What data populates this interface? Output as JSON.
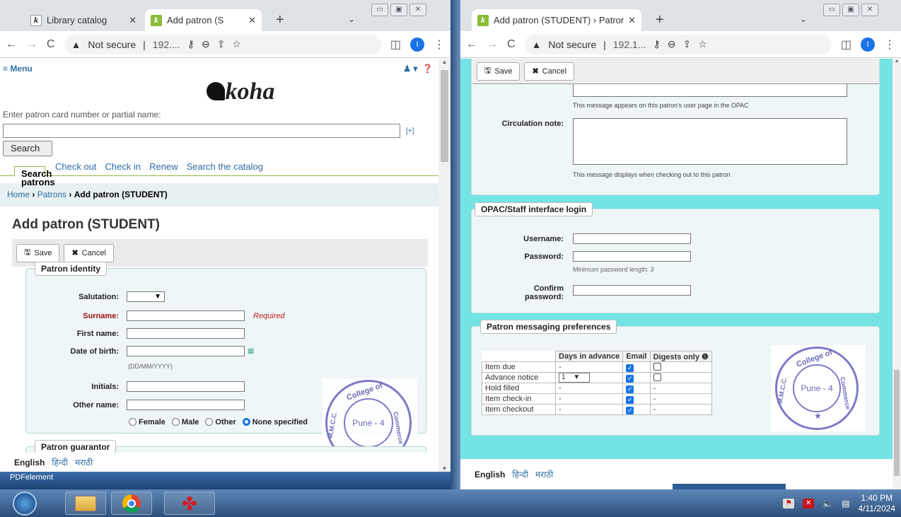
{
  "left_window": {
    "tabs": [
      {
        "title": "Library catalog",
        "close": "✕"
      },
      {
        "title": "Add patron (S",
        "close": "✕"
      }
    ],
    "new_tab": "+",
    "tab_menu": "⌄",
    "address": {
      "security": "Not secure",
      "separator": "|",
      "url": "192...."
    },
    "profile_initial": "I",
    "page": {
      "menu_label": "≡ Menu",
      "logo_text": "koha",
      "search_prompt": "Enter patron card number or partial name:",
      "search_more": "[+]",
      "search_button": "Search",
      "nav_tabs": [
        "Search patrons",
        "Check out",
        "Check in",
        "Renew",
        "Search the catalog"
      ],
      "breadcrumb": {
        "home": "Home",
        "sep": "›",
        "patrons": "Patrons",
        "current": "Add patron (STUDENT)"
      },
      "title": "Add patron (STUDENT)",
      "save_label": "Save",
      "cancel_label": "Cancel",
      "patron_identity": {
        "legend": "Patron identity",
        "salutation_label": "Salutation:",
        "surname_label": "Surname:",
        "required_text": "Required",
        "first_name_label": "First name:",
        "dob_label": "Date of birth:",
        "dob_hint": "(DD/MM/YYYY)",
        "initials_label": "Initials:",
        "other_name_label": "Other name:",
        "gender_options": [
          "Female",
          "Male",
          "Other",
          "None specified"
        ],
        "gender_selected": "None specified"
      },
      "patron_guarantor_legend": "Patron guarantor",
      "stamp": {
        "top": "College of",
        "center": "Pune - 4",
        "right": "Commerce",
        "left": "M.M.C.C."
      }
    },
    "footer_languages": [
      "English",
      "हिन्दी",
      "मराठी"
    ],
    "behind_label": "PDFelement"
  },
  "right_window": {
    "tabs": [
      {
        "title": "Add patron (STUDENT) › Patrons",
        "close": "✕"
      }
    ],
    "new_tab": "+",
    "tab_menu": "⌄",
    "address": {
      "security": "Not secure",
      "separator": "|",
      "url": "192.1..."
    },
    "profile_initial": "I",
    "page": {
      "save_label": "Save",
      "cancel_label": "Cancel",
      "opac_note_hint": "This message appears on this patron's user page in the OPAC",
      "circ_note_label": "Circulation note:",
      "circ_note_hint": "This message displays when checking out to this patron",
      "login": {
        "legend": "OPAC/Staff interface login",
        "username_label": "Username:",
        "password_label": "Password:",
        "password_hint": "Minimum password length: 3",
        "confirm_label_1": "Confirm",
        "confirm_label_2": "password:"
      },
      "messaging": {
        "legend": "Patron messaging preferences",
        "headers": [
          "",
          "Days in advance",
          "Email",
          "Digests only"
        ],
        "rows": [
          {
            "name": "Item due",
            "days": "-",
            "email": true,
            "digest": "checkbox"
          },
          {
            "name": "Advance notice",
            "days": "1",
            "email": true,
            "digest": "checkbox"
          },
          {
            "name": "Hold filled",
            "days": "-",
            "email": true,
            "digest": "-"
          },
          {
            "name": "Item check-in",
            "days": "-",
            "email": true,
            "digest": "-"
          },
          {
            "name": "Item checkout",
            "days": "-",
            "email": true,
            "digest": "-"
          }
        ]
      },
      "stamp": {
        "top": "College of",
        "center": "Pune - 4",
        "right": "Commerce",
        "left": "M.M.C.C."
      }
    },
    "footer_languages": [
      "English",
      "हिन्दी",
      "मराठी"
    ]
  },
  "taskbar": {
    "items": [
      "start-orb",
      "file-explorer",
      "chrome",
      "pdf-app"
    ],
    "time": "1:40 PM",
    "date": "4/11/2024"
  },
  "colors": {
    "link": "#2e6da4",
    "koha_green": "#8bbb3a",
    "fieldset_bg": "#eef6f7",
    "right_bg": "#74e3e3",
    "required": "#a31313"
  }
}
